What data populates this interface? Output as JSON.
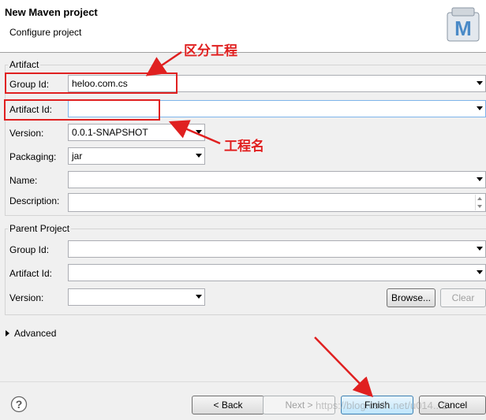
{
  "header": {
    "title": "New Maven project",
    "subtitle": "Configure project",
    "logo_letter": "M"
  },
  "artifact": {
    "group_title": "Artifact",
    "group_id_label": "Group Id:",
    "group_id_value": "heloo.com.cs",
    "artifact_id_label": "Artifact Id:",
    "artifact_id_value": "",
    "version_label": "Version:",
    "version_value": "0.0.1-SNAPSHOT",
    "packaging_label": "Packaging:",
    "packaging_value": "jar",
    "name_label": "Name:",
    "name_value": "",
    "description_label": "Description:",
    "description_value": ""
  },
  "parent": {
    "group_title": "Parent Project",
    "group_id_label": "Group Id:",
    "artifact_id_label": "Artifact Id:",
    "version_label": "Version:",
    "browse_label": "Browse...",
    "clear_label": "Clear"
  },
  "advanced": {
    "label": "Advanced"
  },
  "footer": {
    "back_label": "< Back",
    "next_label": "Next >",
    "finish_label": "Finish",
    "cancel_label": "Cancel",
    "watermark": "https://blog.csdn.net/u014...2"
  },
  "annotations": {
    "group_note": "区分工程",
    "artifact_note": "工程名"
  },
  "colors": {
    "annotation": "#e02020",
    "logo_bg": "#4a8ac7"
  }
}
